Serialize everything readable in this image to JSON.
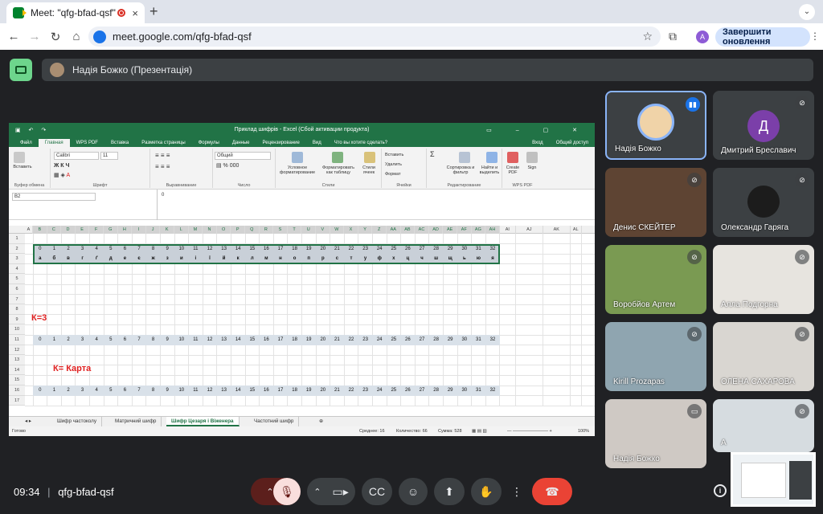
{
  "browser": {
    "tab_title": "Meet: \"qfg-bfad-qsf\"",
    "tab_close": "×",
    "new_tab": "+",
    "url": "meet.google.com/qfg-bfad-qsf",
    "profile_initial": "A",
    "update_label": "Завершити оновлення"
  },
  "meet": {
    "presenter_label": "Надія Божко (Презентація)",
    "clock": "09:34",
    "separator": "|",
    "meeting_code": "qfg-bfad-qsf"
  },
  "excel": {
    "title": "Приклад шифрів - Excel (Сбой активации продукта)",
    "menu": [
      "Файл",
      "Главная",
      "WPS PDF",
      "Вставка",
      "Разметка страницы",
      "Формулы",
      "Данные",
      "Рецензирование",
      "Вид",
      "Что вы хотите сделать?"
    ],
    "menu_right": [
      "Вход",
      "Общий доступ"
    ],
    "ribbon": {
      "paste": "Вставить",
      "clipboard": "Буфер обмена",
      "font_name": "Calibri",
      "font_size": "11",
      "font_group": "Шрифт",
      "align_group": "Выравнивание",
      "number_format": "Общий",
      "number_group": "Число",
      "cond_format": "Условное форматирование",
      "table_format": "Форматировать как таблицу",
      "cell_styles": "Стили ячеек",
      "styles_group": "Стили",
      "insert": "Вставить",
      "delete": "Удалить",
      "format": "Формат",
      "cells_group": "Ячейки",
      "sort": "Сортировка и фильтр",
      "find": "Найти и выделить",
      "edit_group": "Редактирование",
      "create_pdf": "Create PDF",
      "sign": "Sign",
      "wps_group": "WPS PDF"
    },
    "name_box": "B2",
    "formula": "0",
    "columns": [
      "A",
      "B",
      "C",
      "D",
      "E",
      "F",
      "G",
      "H",
      "I",
      "J",
      "K",
      "L",
      "M",
      "N",
      "O",
      "P",
      "Q",
      "R",
      "S",
      "T",
      "U",
      "V",
      "W",
      "X",
      "Y",
      "Z",
      "AA",
      "AB",
      "AC",
      "AD",
      "AE",
      "AF",
      "AG",
      "AH",
      "AI",
      "AJ",
      "AK",
      "AL"
    ],
    "rows": [
      "1",
      "2",
      "3",
      "4",
      "5",
      "6",
      "7",
      "8",
      "9",
      "10",
      "11",
      "12",
      "13",
      "14",
      "15",
      "16",
      "17"
    ],
    "numbers": [
      "0",
      "1",
      "2",
      "3",
      "4",
      "5",
      "6",
      "7",
      "8",
      "9",
      "10",
      "11",
      "12",
      "13",
      "14",
      "15",
      "16",
      "17",
      "18",
      "19",
      "20",
      "21",
      "22",
      "23",
      "24",
      "25",
      "26",
      "27",
      "28",
      "29",
      "30",
      "31",
      "32"
    ],
    "letters": [
      "а",
      "б",
      "в",
      "г",
      "ґ",
      "д",
      "е",
      "є",
      "ж",
      "з",
      "и",
      "і",
      "ї",
      "й",
      "к",
      "л",
      "м",
      "н",
      "о",
      "п",
      "р",
      "с",
      "т",
      "у",
      "ф",
      "х",
      "ц",
      "ч",
      "ш",
      "щ",
      "ь",
      "ю",
      "я"
    ],
    "k3_label": "К=3",
    "kkarta_label": "К= Карта",
    "sheet_tabs": [
      "Шифр частоколу",
      "Матричний шифр",
      "Шифр Цезаря і Віженера",
      "Частотний шифр"
    ],
    "active_sheet": 2,
    "status_ready": "Готово",
    "status_avg": "Среднее: 16",
    "status_count": "Количество: 66",
    "status_sum": "Сумма: 528",
    "zoom": "100%"
  },
  "participants": [
    {
      "name": "Надія Божко",
      "speaking": true
    },
    {
      "name": "Дмитрий Бреславич",
      "initial": "Д",
      "avatar_color": "#7b3fa9"
    },
    {
      "name": "Денис СКЕЙТЕР"
    },
    {
      "name": "Олександр Гаряга"
    },
    {
      "name": "Воробйов Артем"
    },
    {
      "name": "Алла Подгорна"
    },
    {
      "name": "Kirill Prozapas"
    },
    {
      "name": "ОЛЕНА САХАРОВА"
    },
    {
      "name": "Надія Божко"
    },
    {
      "name": "А"
    }
  ],
  "colors": {
    "meet_bg": "#202124",
    "excel_green": "#217346",
    "end_call": "#ea4335",
    "mic_off": "#f9dedc",
    "red_label": "#e02020"
  }
}
